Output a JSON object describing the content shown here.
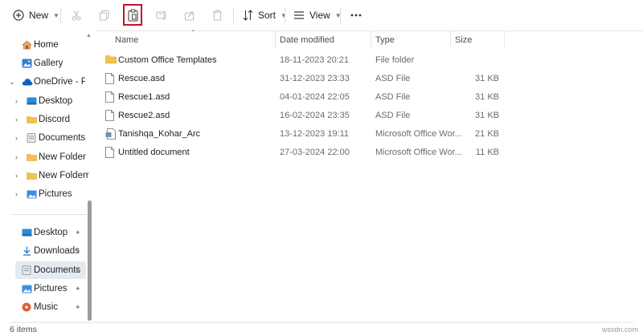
{
  "toolbar": {
    "new_label": "New",
    "sort_label": "Sort",
    "view_label": "View"
  },
  "sidebar": {
    "home": "Home",
    "gallery": "Gallery",
    "onedrive": "OneDrive - Perso",
    "tree": [
      "Desktop",
      "Discord",
      "Documents",
      "New Folder",
      "New Folderr",
      "Pictures"
    ],
    "quick_access": [
      "Desktop",
      "Downloads",
      "Documents",
      "Pictures",
      "Music"
    ]
  },
  "columns": {
    "name": "Name",
    "date": "Date modified",
    "type": "Type",
    "size": "Size"
  },
  "files": [
    {
      "name": "Custom Office Templates",
      "date": "18-11-2023 20:21",
      "type": "File folder",
      "size": "",
      "icon": "folder-icon"
    },
    {
      "name": "Rescue.asd",
      "date": "31-12-2023 23:33",
      "type": "ASD File",
      "size": "31 KB",
      "icon": "file-icon"
    },
    {
      "name": "Rescue1.asd",
      "date": "04-01-2024 22:05",
      "type": "ASD File",
      "size": "31 KB",
      "icon": "file-icon"
    },
    {
      "name": "Rescue2.asd",
      "date": "16-02-2024 23:35",
      "type": "ASD File",
      "size": "31 KB",
      "icon": "file-icon"
    },
    {
      "name": "Tanishqa_Kohar_Arc",
      "date": "13-12-2023 19:11",
      "type": "Microsoft Office Wor...",
      "size": "21 KB",
      "icon": "word-doc-icon"
    },
    {
      "name": "Untitled document",
      "date": "27-03-2024 22:00",
      "type": "Microsoft Office Wor...",
      "size": "11 KB",
      "icon": "file-icon"
    }
  ],
  "status": {
    "item_count": "6 items"
  },
  "watermark": "wsxdn.com",
  "colors": {
    "highlight": "#c8102e",
    "folder": "#f2c14e",
    "accent": "#0a64c8",
    "selected_bg": "#e5eaf1"
  }
}
